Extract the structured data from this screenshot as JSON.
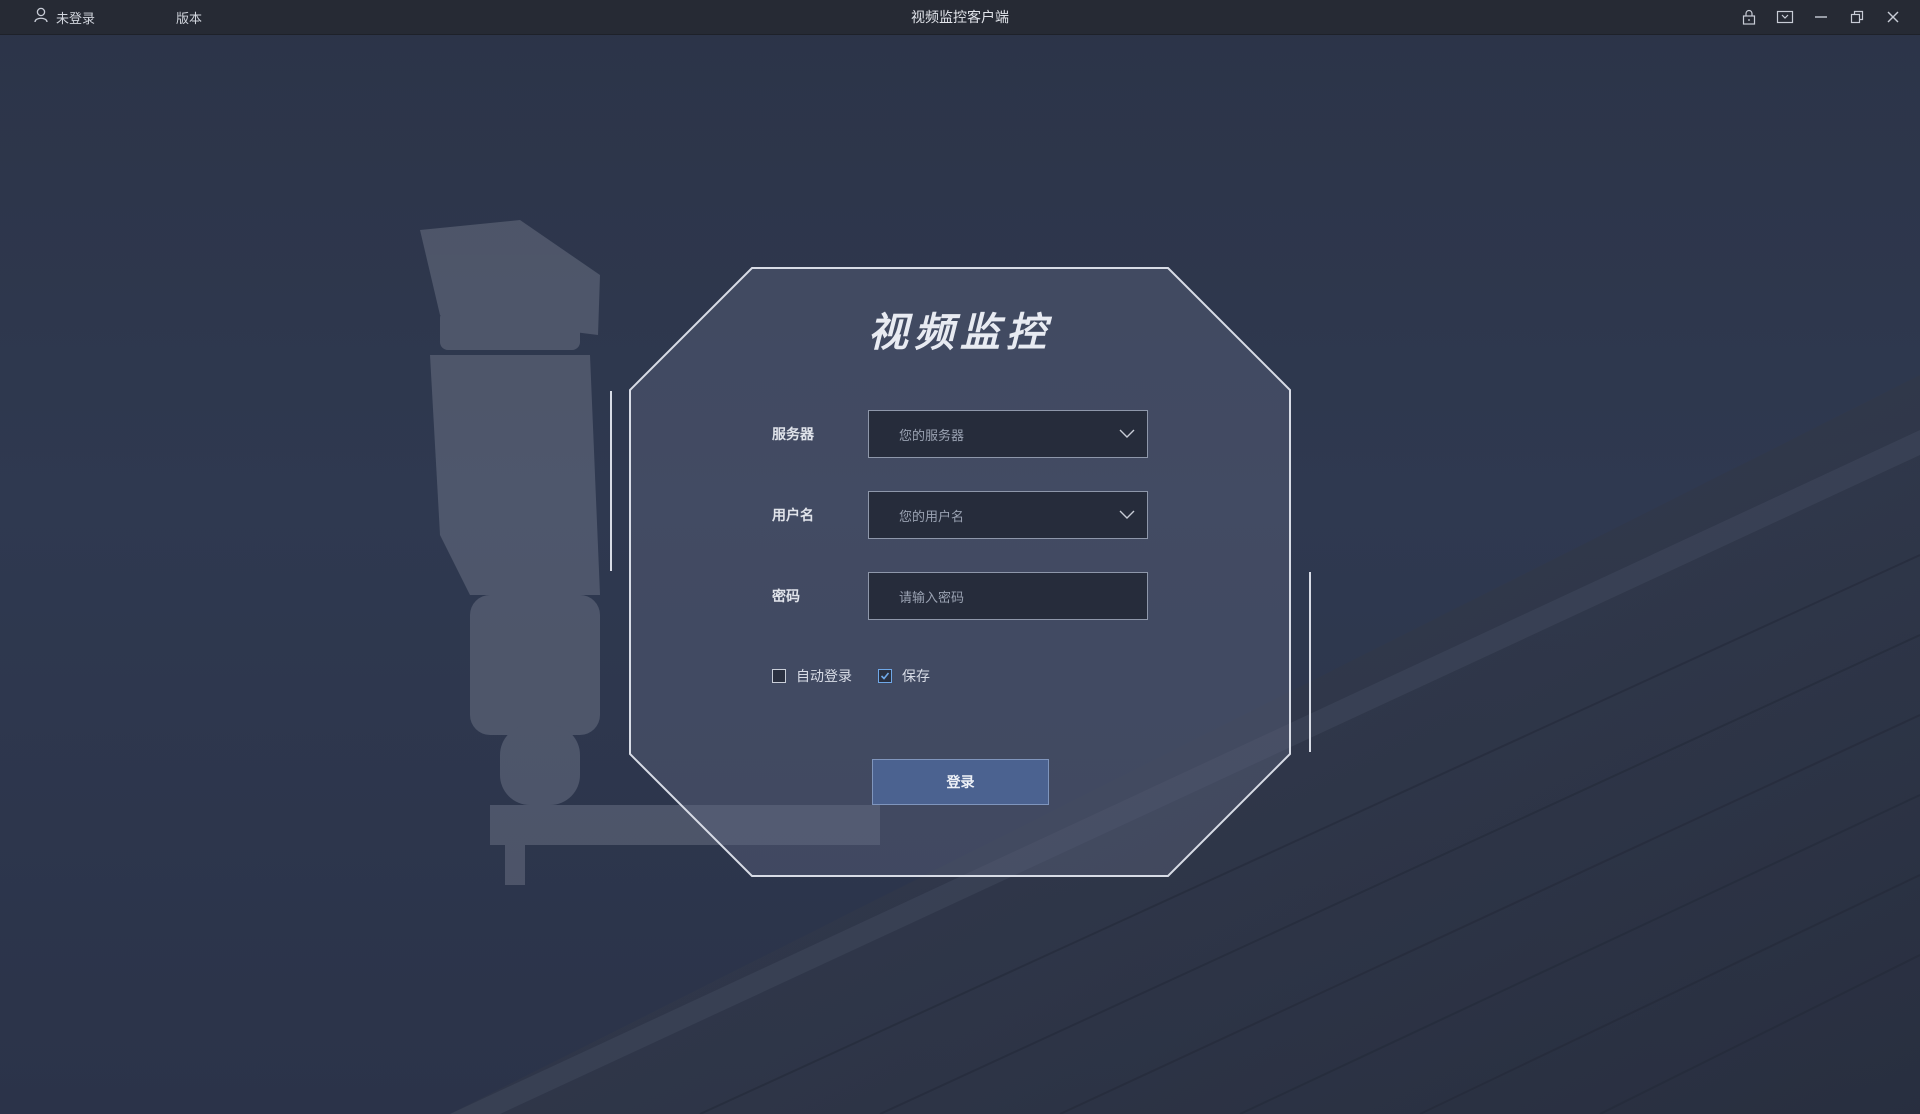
{
  "titlebar": {
    "user_status": "未登录",
    "version_label": "版本",
    "app_title": "视频监控客户端",
    "controls": [
      "lock-icon",
      "dropdown-window-icon",
      "minimize-icon",
      "restore-icon",
      "close-icon"
    ]
  },
  "login": {
    "title": "视频监控",
    "server": {
      "label": "服务器",
      "placeholder": "您的服务器"
    },
    "username": {
      "label": "用户名",
      "placeholder": "您的用户名"
    },
    "password": {
      "label": "密码",
      "placeholder": "请输入密码"
    },
    "auto_login": {
      "label": "自动登录",
      "checked": false
    },
    "save": {
      "label": "保存",
      "checked": true
    },
    "submit_label": "登录"
  },
  "colors": {
    "titlebar_bg": "#262a34",
    "background": "#2f3950",
    "panel_border": "#d8dce6",
    "button_bg": "#4b6290",
    "checkbox_accent": "#6fa8e8"
  }
}
